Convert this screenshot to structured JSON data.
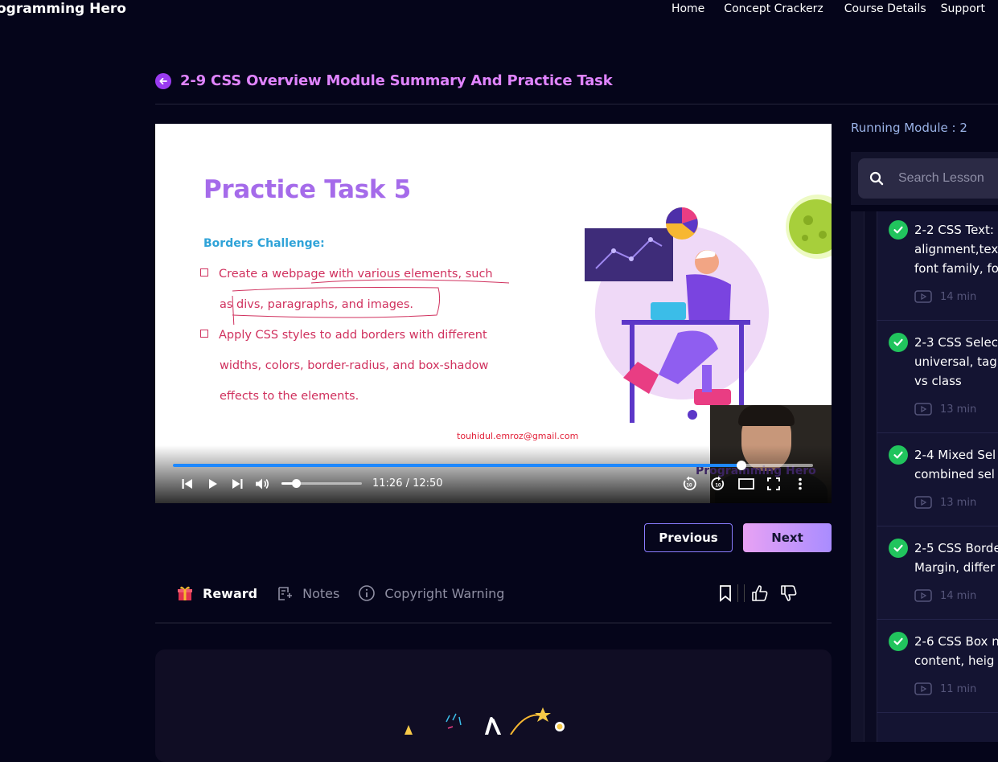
{
  "brand": "ogramming Hero",
  "nav": [
    "Home",
    "Concept Crackerz",
    "Course Details",
    "Support"
  ],
  "lesson_title": "2-9 CSS Overview Module Summary And Practice Task",
  "video": {
    "slide_title": "Practice Task 5",
    "slide_subtitle": "Borders Challenge:",
    "bullet1_line1": "Create a webpage with various elements, such",
    "bullet1_line2": "as divs, paragraphs, and images.",
    "bullet2_line1": "Apply CSS styles to add borders with different",
    "bullet2_line2": "widths, colors, border-radius, and box-shadow",
    "bullet2_line3": "effects to the elements.",
    "email": "touhidul.emroz@gmail.com",
    "watermark": "Programming Hero",
    "time": "11:26 / 12:50",
    "progress": 0.888,
    "volume": 0.18,
    "icons": [
      "skip-back-icon",
      "play-icon",
      "skip-forward-icon",
      "volume-icon",
      "rewind-10-icon",
      "forward-10-icon",
      "theater-icon",
      "fullscreen-icon",
      "more-icon"
    ]
  },
  "buttons": {
    "previous": "Previous",
    "next": "Next"
  },
  "tabs": [
    {
      "label": "Reward",
      "icon": "gift-icon",
      "active": true
    },
    {
      "label": "Notes",
      "icon": "notes-icon",
      "active": false
    },
    {
      "label": "Copyright Warning",
      "icon": "info-icon",
      "active": false
    }
  ],
  "tab_actions": [
    "bookmark-icon",
    "thumbs-up-icon",
    "thumbs-down-icon"
  ],
  "sidebar": {
    "running_module": "Running Module : 2",
    "search_placeholder": "Search Lesson",
    "lessons": [
      {
        "title": "2-2 CSS Text:\nalignment,tex\nfont family, fo",
        "duration": "14 min",
        "completed": true
      },
      {
        "title": "2-3 CSS Selec\nuniversal, tag\nvs class",
        "duration": "13 min",
        "completed": true
      },
      {
        "title": "2-4 Mixed Sel\ncombined sel",
        "duration": "13 min",
        "completed": true
      },
      {
        "title": "2-5 CSS Borde\nMargin, differ",
        "duration": "14 min",
        "completed": true
      },
      {
        "title": "2-6 CSS Box n\ncontent, heig",
        "duration": "11 min",
        "completed": true
      }
    ]
  },
  "colors": {
    "accent": "#e084ff",
    "background": "#05051a",
    "check": "#21c45d",
    "progress": "#1e88ff"
  }
}
